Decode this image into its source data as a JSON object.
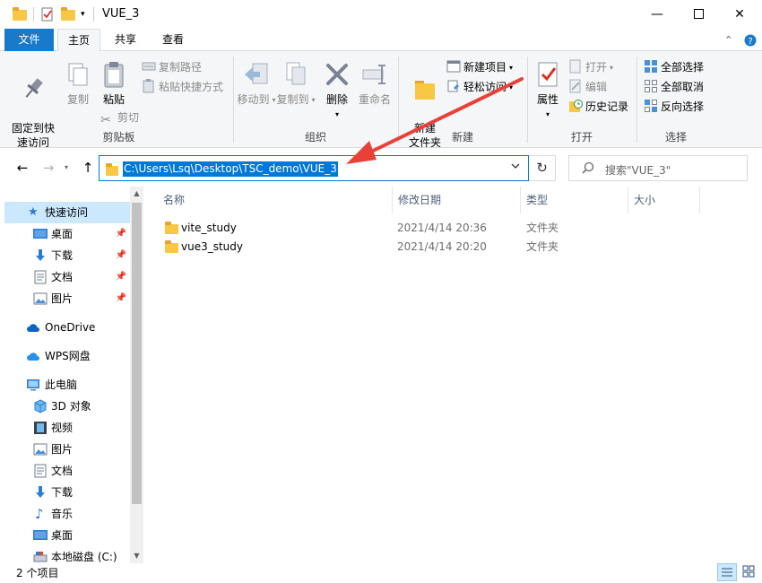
{
  "window": {
    "title": "VUE_3"
  },
  "tabs": {
    "file": "文件",
    "home": "主页",
    "share": "共享",
    "view": "查看"
  },
  "ribbon": {
    "clipboard": {
      "label": "剪贴板",
      "pin_quick_access": "固定到快\n速访问",
      "copy": "复制",
      "paste": "粘贴",
      "copy_path": "复制路径",
      "paste_shortcut": "粘贴快捷方式",
      "cut": "剪切"
    },
    "organize": {
      "label": "组织",
      "move_to": "移动到",
      "copy_to": "复制到",
      "delete": "删除",
      "rename": "重命名"
    },
    "new": {
      "label": "新建",
      "new_folder": "新建\n文件夹",
      "new_item": "新建项目",
      "easy_access": "轻松访问"
    },
    "open": {
      "label": "打开",
      "properties": "属性",
      "open": "打开",
      "edit": "编辑",
      "history": "历史记录"
    },
    "select": {
      "label": "选择",
      "select_all": "全部选择",
      "select_none": "全部取消",
      "invert": "反向选择"
    }
  },
  "address": {
    "path": "C:\\Users\\Lsq\\Desktop\\TSC_demo\\VUE_3",
    "search_placeholder": "搜索\"VUE_3\""
  },
  "nav": {
    "quick_access": "快速访问",
    "desktop": "桌面",
    "downloads": "下载",
    "documents": "文档",
    "pictures": "图片",
    "onedrive": "OneDrive",
    "wps": "WPS网盘",
    "this_pc": "此电脑",
    "objects3d": "3D 对象",
    "videos": "视频",
    "pictures2": "图片",
    "documents2": "文档",
    "downloads2": "下载",
    "music": "音乐",
    "desktop2": "桌面",
    "local_disk": "本地磁盘 (C:)"
  },
  "columns": {
    "name": "名称",
    "modified": "修改日期",
    "type": "类型",
    "size": "大小"
  },
  "files": [
    {
      "name": "vite_study",
      "modified": "2021/4/14 20:36",
      "type": "文件夹"
    },
    {
      "name": "vue3_study",
      "modified": "2021/4/14 20:20",
      "type": "文件夹"
    }
  ],
  "status": {
    "item_count": "2 个项目"
  },
  "colors": {
    "accent": "#0078d7",
    "file_tab": "#1979ca",
    "folder": "#f8c845",
    "selection": "#cce8ff",
    "annotation_arrow": "#e8413a"
  }
}
